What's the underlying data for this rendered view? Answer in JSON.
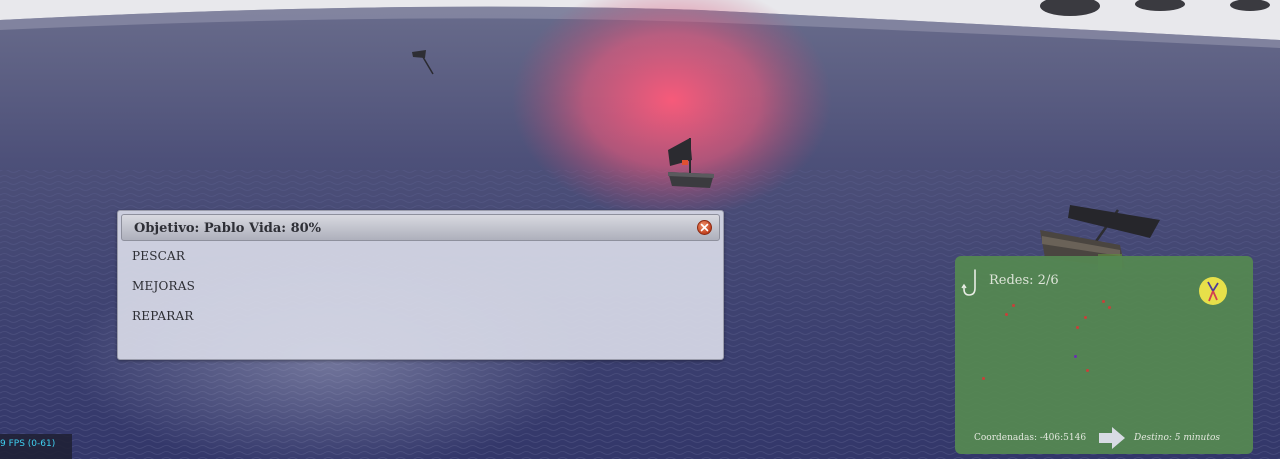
{
  "dialog": {
    "title": "Objetivo: Pablo Vida: 80%",
    "menu": [
      {
        "label": "PESCAR"
      },
      {
        "label": "MEJORAS"
      },
      {
        "label": "REPARAR"
      }
    ]
  },
  "fps": {
    "text": "9 FPS (0-61)"
  },
  "map": {
    "nets": "Redes: 2/6",
    "coords": "Coordenadas: -406:5146",
    "destination": "Destino: 5 minutos",
    "icons": [
      "hook-icon",
      "compass-icon",
      "direction-arrow-icon"
    ]
  },
  "colors": {
    "sea": "#3f4270",
    "glow": "#ff5a78",
    "map_panel": "#548652",
    "fps_text": "#3fd0f0",
    "close_button": "#c2411f"
  }
}
